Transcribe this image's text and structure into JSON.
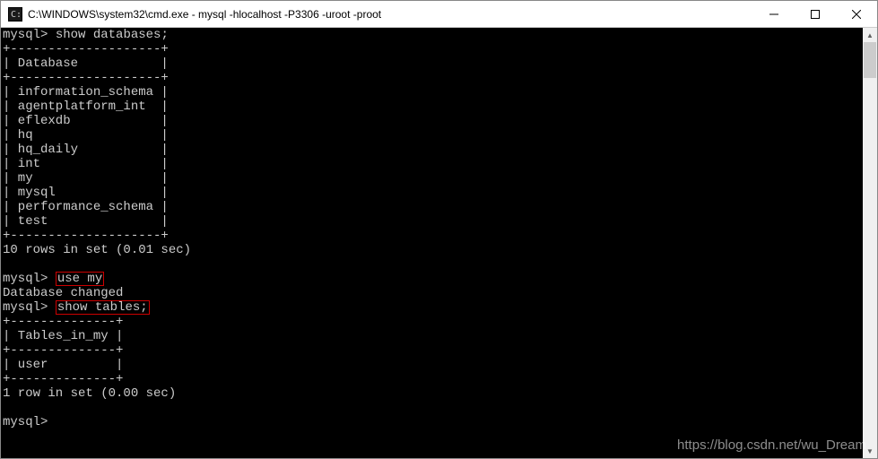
{
  "titlebar": {
    "title": "C:\\WINDOWS\\system32\\cmd.exe - mysql  -hlocalhost -P3306 -uroot -proot"
  },
  "terminal": {
    "prompt": "mysql>",
    "cmd_show_databases": "show databases;",
    "db_table": {
      "top": "+--------------------+",
      "header": "| Database           |",
      "sep": "+--------------------+",
      "rows": [
        "| information_schema |",
        "| agentplatform_int  |",
        "| eflexdb            |",
        "| hq                 |",
        "| hq_daily           |",
        "| int                |",
        "| my                 |",
        "| mysql              |",
        "| performance_schema |",
        "| test               |"
      ],
      "bottom": "+--------------------+"
    },
    "db_result_summary": "10 rows in set (0.01 sec)",
    "cmd_use_my": "use my",
    "db_changed": "Database changed",
    "cmd_show_tables": "show tables;",
    "tbl_table": {
      "top": "+--------------+",
      "header": "| Tables_in_my |",
      "sep": "+--------------+",
      "rows": [
        "| user         |"
      ],
      "bottom": "+--------------+"
    },
    "tbl_result_summary": "1 row in set (0.00 sec)"
  },
  "watermark": "https://blog.csdn.net/wu_Dream"
}
